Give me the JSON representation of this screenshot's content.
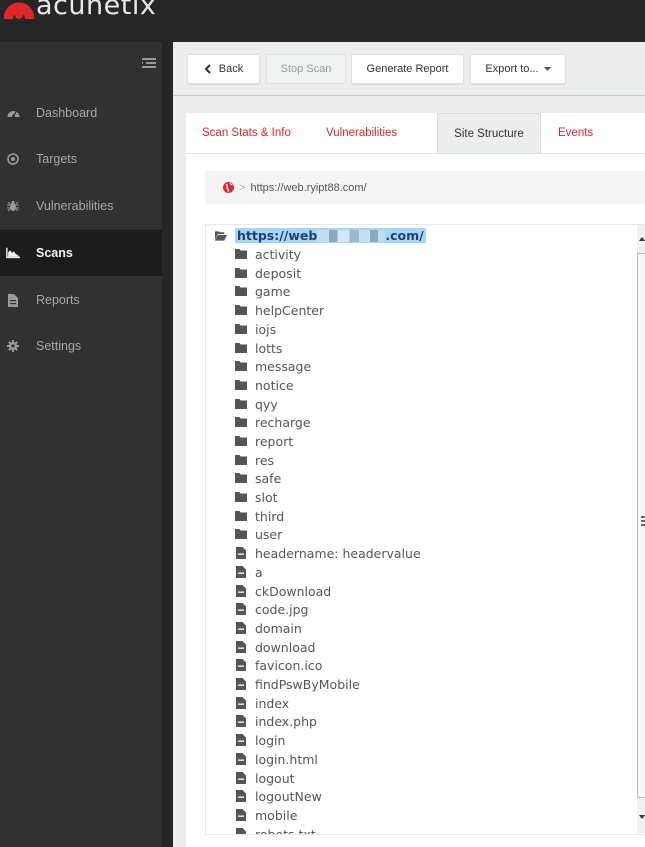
{
  "app": {
    "logo_text": "acunetix",
    "brand_color": "#e0262d"
  },
  "sidebar": {
    "items": [
      {
        "label": "Dashboard",
        "icon": "dashboard-icon",
        "active": false
      },
      {
        "label": "Targets",
        "icon": "target-icon",
        "active": false
      },
      {
        "label": "Vulnerabilities",
        "icon": "bug-icon",
        "active": false
      },
      {
        "label": "Scans",
        "icon": "area-chart-icon",
        "active": true
      },
      {
        "label": "Reports",
        "icon": "file-icon",
        "active": false
      },
      {
        "label": "Settings",
        "icon": "gear-icon",
        "active": false
      }
    ]
  },
  "toolbar": {
    "back_label": "Back",
    "stop_label": "Stop Scan",
    "generate_label": "Generate Report",
    "export_label": "Export to..."
  },
  "tabs": [
    {
      "label": "Scan Stats & Info",
      "active": false
    },
    {
      "label": "Vulnerabilities",
      "active": false
    },
    {
      "label": "Site Structure",
      "active": true
    },
    {
      "label": "Events",
      "active": false
    }
  ],
  "breadcrumb": {
    "separator": ">",
    "path": "https://web.ryipt88.com/"
  },
  "tree": {
    "root_prefix": "https://web",
    "root_suffix": ".com/",
    "folders": [
      "activity",
      "deposit",
      "game",
      "helpCenter",
      "iojs",
      "lotts",
      "message",
      "notice",
      "qyy",
      "recharge",
      "report",
      "res",
      "safe",
      "slot",
      "third",
      "user"
    ],
    "files": [
      "headername: headervalue",
      "a",
      "ckDownload",
      "code.jpg",
      "domain",
      "download",
      "favicon.ico",
      "findPswByMobile",
      "index",
      "index.php",
      "login",
      "login.html",
      "logout",
      "logoutNew",
      "mobile",
      "robots.txt"
    ]
  }
}
